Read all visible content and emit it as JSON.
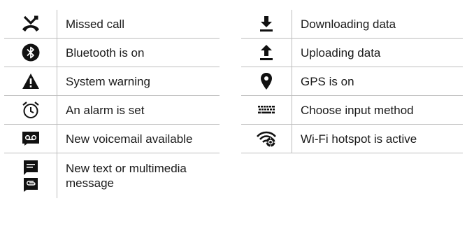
{
  "left_table": [
    {
      "icon": "missed-call-icon",
      "label": "Missed call"
    },
    {
      "icon": "bluetooth-icon",
      "label": "Bluetooth is on"
    },
    {
      "icon": "warning-icon",
      "label": "System warning"
    },
    {
      "icon": "alarm-clock-icon",
      "label": "An alarm is set"
    },
    {
      "icon": "voicemail-icon",
      "label": "New voicemail available"
    },
    {
      "icon": "message-icon",
      "label": "New text or multimedia\nmessage"
    }
  ],
  "right_table": [
    {
      "icon": "download-icon",
      "label": "Downloading data"
    },
    {
      "icon": "upload-icon",
      "label": "Uploading data"
    },
    {
      "icon": "location-pin-icon",
      "label": "GPS is on"
    },
    {
      "icon": "keyboard-icon",
      "label": "Choose input method"
    },
    {
      "icon": "wifi-hotspot-icon",
      "label": "Wi-Fi hotspot is active"
    }
  ]
}
